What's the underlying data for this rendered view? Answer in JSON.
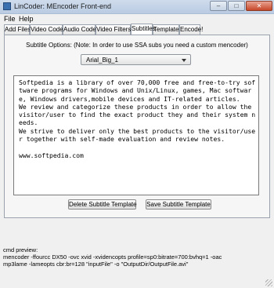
{
  "window": {
    "title": "LinCoder: MEncoder Front-end",
    "minimize": "–",
    "maximize": "□",
    "close": "✕"
  },
  "menu": [
    {
      "label": "File"
    },
    {
      "label": "Help"
    }
  ],
  "tabs": [
    {
      "label": "Add Files"
    },
    {
      "label": "Video Codec"
    },
    {
      "label": "Audio Codec"
    },
    {
      "label": "Video Filters"
    },
    {
      "label": "Subtitles",
      "active": true
    },
    {
      "label": "Templates"
    },
    {
      "label": "Encode!"
    }
  ],
  "subtitles": {
    "options_label": "Subtitle Options: (Note: In order to use SSA subs you need a custom mencoder)",
    "template_select": "Arial_Big_1",
    "text": "Softpedia is a library of over 70,000 free and free-to-try software programs for Windows and Unix/Linux, games, Mac software, Windows drivers,mobile devices and IT-related articles.\nWe review and categorize these products in order to allow the visitor/user to find the exact product they and their system needs.\nWe strive to deliver only the best products to the visitor/user together with self-made evaluation and review notes.\n\nwww.softpedia.com",
    "delete_button": "Delete Subtitle Template",
    "save_button": "Save Subtitle Template"
  },
  "cmd_preview": {
    "label": "cmd preview:",
    "lines": [
      "mencoder -ffourcc DX50 -ovc xvid -xvidencopts profile=sp0:bitrate=700:bvhq=1 -oac",
      "mp3lame -lameopts cbr:br=128 \"inputFile\" -o \"OutputDir/OutputFile.avi\""
    ]
  }
}
